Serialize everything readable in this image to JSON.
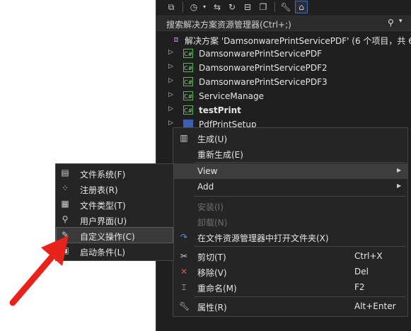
{
  "search": {
    "placeholder": "搜索解决方案资源管理器(Ctrl+;)"
  },
  "tree": [
    {
      "label": "解决方案 'DamsonwarePrintServicePDF' (6 个项目，共 6",
      "kind": "solution"
    },
    {
      "label": "DamsonwarePrintServicePDF",
      "kind": "csproj"
    },
    {
      "label": "DamsonwarePrintServicePDF2",
      "kind": "csproj"
    },
    {
      "label": "DamsonwarePrintServicePDF3",
      "kind": "csproj"
    },
    {
      "label": "ServiceManage",
      "kind": "csproj"
    },
    {
      "label": "testPrint",
      "kind": "csproj",
      "bold": true
    },
    {
      "label": "PdfPrintSetup",
      "kind": "setup"
    }
  ],
  "project_icon_text": "C#",
  "context_menu": {
    "build": "生成(U)",
    "rebuild": "重新生成(E)",
    "view": "View",
    "add": "Add",
    "install": "安装(I)",
    "uninstall": "卸载(N)",
    "open_folder": "在文件资源管理器中打开文件夹(X)",
    "cut": "剪切(T)",
    "cut_shortcut": "Ctrl+X",
    "remove": "移除(V)",
    "remove_shortcut": "Del",
    "rename": "重命名(M)",
    "rename_shortcut": "F2",
    "properties": "属性(R)",
    "properties_shortcut": "Alt+Enter"
  },
  "view_submenu": [
    {
      "label": "文件系统(F)",
      "icon": "file-system-icon"
    },
    {
      "label": "注册表(R)",
      "icon": "registry-icon"
    },
    {
      "label": "文件类型(T)",
      "icon": "file-types-icon"
    },
    {
      "label": "用户界面(U)",
      "icon": "user-interface-icon"
    },
    {
      "label": "自定义操作(C)",
      "icon": "custom-actions-icon"
    },
    {
      "label": "启动条件(L)",
      "icon": "launch-conditions-icon"
    }
  ],
  "colors": {
    "annotation_arrow": "#e8231c",
    "panel_bg": "#1f1f1f",
    "menu_bg": "#252526"
  }
}
